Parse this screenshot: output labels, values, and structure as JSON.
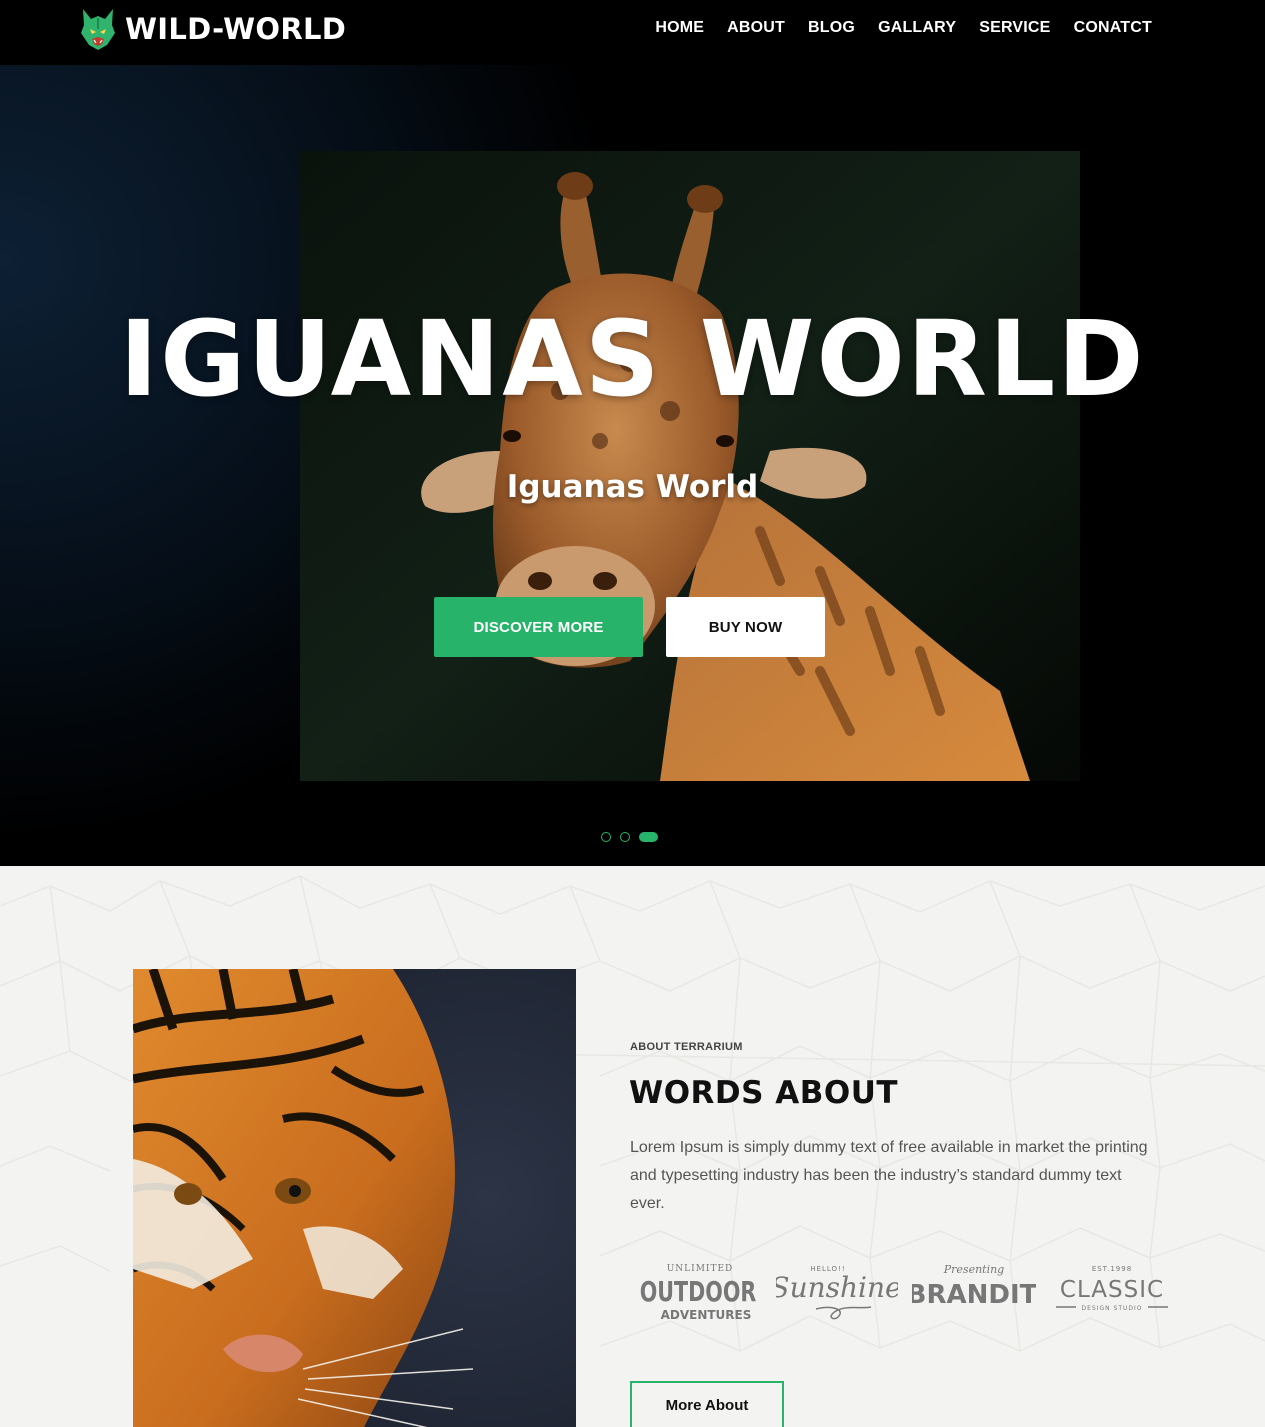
{
  "header": {
    "brand": "WILD-WORLD",
    "logo_icon": "wolf-head-icon",
    "nav": [
      "HOME",
      "ABOUT",
      "BLOG",
      "GALLARY",
      "SERVICE",
      "CONATCT"
    ]
  },
  "hero": {
    "title": "IGUANAS WORLD",
    "subtitle": "Iguanas World",
    "primary_button": "DISCOVER MORE",
    "secondary_button": "BUY NOW",
    "slide_count": 3,
    "active_slide": 3
  },
  "about": {
    "eyebrow": "ABOUT TERRARIUM",
    "heading": "WORDS ABOUT",
    "description": "Lorem Ipsum is simply dummy text of free available in market the printing and typesetting industry has been the industry’s standard dummy text ever.",
    "button": "More About",
    "brands": [
      {
        "top": "UNLIMITED",
        "main": "OUTDOOR",
        "bottom": "ADVENTURES"
      },
      {
        "top": "HELLO!!",
        "main": "Sunshine"
      },
      {
        "top": "Presenting",
        "main": "BRANDIT"
      },
      {
        "top": "EST.1998",
        "main": "CLASSIC",
        "bottom": "DESIGN STUDIO"
      }
    ]
  },
  "colors": {
    "accent": "#27b36a",
    "header_bg": "#000000",
    "section_bg": "#f3f4f1",
    "text_dark": "#111111",
    "text_muted": "#555555"
  }
}
